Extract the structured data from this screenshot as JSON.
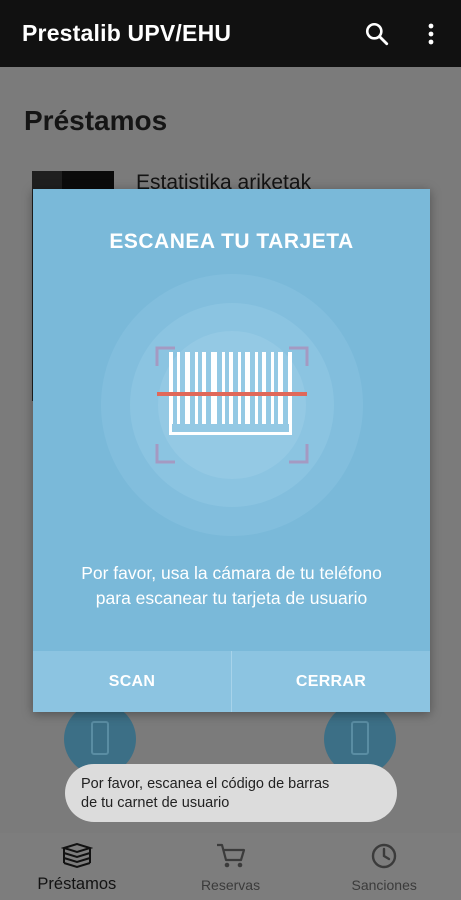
{
  "app_bar": {
    "title": "Prestalib UPV/EHU",
    "search_icon": "search-icon",
    "more_icon": "more-vert-icon"
  },
  "page": {
    "title": "Préstamos",
    "book_title": "Estatistika ariketak"
  },
  "dialog": {
    "title": "ESCANEA TU TARJETA",
    "message_line1": "Por favor, usa la cámara de tu teléfono",
    "message_line2": "para escanear tu tarjeta de usuario",
    "scan_label": "SCAN",
    "close_label": "CERRAR",
    "colors": {
      "background": "#7ab9d9",
      "scan_line": "#e0685a",
      "actions_background": "#8cc4e1"
    }
  },
  "toast": {
    "line1": "Por favor, escanea el código de barras",
    "line2": "de tu carnet de usuario"
  },
  "bottom_nav": {
    "items": [
      {
        "label": "Préstamos",
        "icon": "books-icon",
        "active": true
      },
      {
        "label": "Reservas",
        "icon": "cart-icon",
        "active": false
      },
      {
        "label": "Sanciones",
        "icon": "history-icon",
        "active": false
      }
    ]
  }
}
